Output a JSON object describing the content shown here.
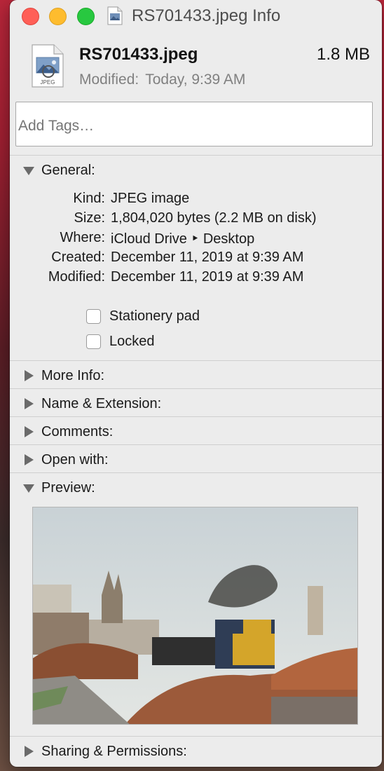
{
  "window": {
    "title": "RS701433.jpeg Info",
    "file_name": "RS701433.jpeg",
    "file_size": "1.8 MB",
    "modified_label": "Modified:",
    "modified_value": "Today, 9:39 AM",
    "icon_label": "JPEG"
  },
  "tags": {
    "placeholder": "Add Tags…"
  },
  "general": {
    "label": "General:",
    "expanded": true,
    "rows": [
      {
        "key": "Kind:",
        "value": "JPEG image"
      },
      {
        "key": "Size:",
        "value": "1,804,020 bytes (2.2 MB on disk)"
      },
      {
        "key": "Where:",
        "value": "iCloud Drive ‣ Desktop"
      },
      {
        "key": "Created:",
        "value": "December 11, 2019 at 9:39 AM"
      },
      {
        "key": "Modified:",
        "value": "December 11, 2019 at 9:39 AM"
      }
    ],
    "checkboxes": [
      {
        "label": "Stationery pad",
        "checked": false
      },
      {
        "label": "Locked",
        "checked": false
      }
    ]
  },
  "sections": {
    "more_info": "More Info:",
    "name_extension": "Name & Extension:",
    "comments": "Comments:",
    "open_with": "Open with:",
    "preview": "Preview:",
    "sharing": "Sharing & Permissions:"
  },
  "colors": {
    "close": "#ff5f57",
    "minimize": "#febc2e",
    "zoom": "#28c840",
    "window_bg": "#ececec"
  }
}
